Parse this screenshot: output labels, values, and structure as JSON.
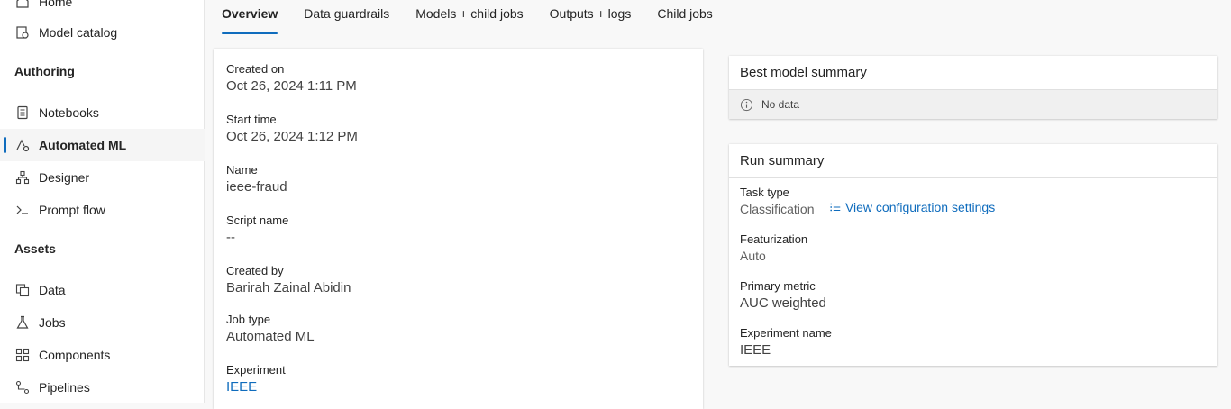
{
  "sidebar": {
    "items_top": [
      {
        "label": "Home",
        "icon": "home-icon"
      },
      {
        "label": "Model catalog",
        "icon": "model-catalog-icon"
      }
    ],
    "authoring": {
      "title": "Authoring",
      "items": [
        {
          "label": "Notebooks",
          "icon": "notebook-icon"
        },
        {
          "label": "Automated ML",
          "icon": "automated-ml-icon"
        },
        {
          "label": "Designer",
          "icon": "designer-icon"
        },
        {
          "label": "Prompt flow",
          "icon": "prompt-flow-icon"
        }
      ]
    },
    "assets": {
      "title": "Assets",
      "items": [
        {
          "label": "Data",
          "icon": "data-icon"
        },
        {
          "label": "Jobs",
          "icon": "jobs-icon"
        },
        {
          "label": "Components",
          "icon": "components-icon"
        },
        {
          "label": "Pipelines",
          "icon": "pipelines-icon"
        }
      ]
    },
    "selected": "Automated ML"
  },
  "tabs": [
    "Overview",
    "Data guardrails",
    "Models + child jobs",
    "Outputs + logs",
    "Child jobs"
  ],
  "active_tab": "Overview",
  "properties": {
    "created_on": {
      "label": "Created on",
      "value": "Oct 26, 2024 1:11 PM"
    },
    "start_time": {
      "label": "Start time",
      "value": "Oct 26, 2024 1:12 PM"
    },
    "name": {
      "label": "Name",
      "value": "ieee-fraud"
    },
    "script_name": {
      "label": "Script name",
      "value": "--"
    },
    "created_by": {
      "label": "Created by",
      "value": "Barirah Zainal Abidin"
    },
    "job_type": {
      "label": "Job type",
      "value": "Automated ML"
    },
    "experiment": {
      "label": "Experiment",
      "value": "IEEE"
    }
  },
  "best_model": {
    "title": "Best model summary",
    "no_data": "No data",
    "icon": "info-icon"
  },
  "run_summary": {
    "title": "Run summary",
    "task_type": {
      "label": "Task type",
      "value": "Classification"
    },
    "config_link": "View configuration settings",
    "featurization": {
      "label": "Featurization",
      "value": "Auto"
    },
    "primary_metric": {
      "label": "Primary metric",
      "value": "AUC weighted"
    },
    "experiment_name": {
      "label": "Experiment name",
      "value": "IEEE"
    }
  },
  "colors": {
    "accent": "#0f6cbd",
    "text": "#242424"
  }
}
